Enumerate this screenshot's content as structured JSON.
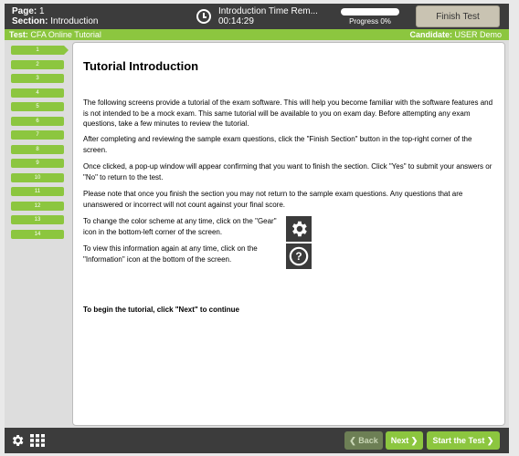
{
  "header": {
    "page_label": "Page:",
    "page_value": "1",
    "section_label": "Section:",
    "section_value": "Introduction",
    "timer_title": "Introduction Time Rem...",
    "timer_value": "00:14:29",
    "progress_label": "Progress 0%",
    "progress_fraction": 0,
    "finish_button": "Finish Test"
  },
  "greenbar": {
    "test_label": "Test:",
    "test_value": "CFA Online Tutorial",
    "candidate_label": "Candidate:",
    "candidate_value": "USER Demo"
  },
  "sidebar": {
    "items": [
      {
        "label": "1"
      },
      {
        "label": "2"
      },
      {
        "label": "3"
      },
      {
        "label": "4"
      },
      {
        "label": "5"
      },
      {
        "label": "6"
      },
      {
        "label": "7"
      },
      {
        "label": "8"
      },
      {
        "label": "9"
      },
      {
        "label": "10"
      },
      {
        "label": "11"
      },
      {
        "label": "12"
      },
      {
        "label": "13"
      },
      {
        "label": "14"
      }
    ]
  },
  "content": {
    "title": "Tutorial Introduction",
    "para1": "The following screens provide a tutorial of the exam software. This will help you become familiar with the software features and is not intended to be a mock exam. This same tutorial will be available to you on exam day. Before attempting any exam questions, take a few minutes to review the tutorial.",
    "para2": "After completing and reviewing the sample exam questions, click the \"Finish Section\" button in the top-right corner of the screen.",
    "para3": "Once clicked, a pop-up window will appear confirming that you want to finish the section. Click \"Yes\" to submit your answers or \"No\" to return to the test.",
    "para4": "Please note that once you finish the section you may not return to the sample exam questions. Any questions that are unanswered or incorrect will not count against your final score.",
    "gear_text": "To change the color scheme at any time, click on the \"Gear\" icon in the bottom-left corner of the screen.",
    "info_text": "To view this information again at any time, click on the \"Information\" icon at the bottom of the screen.",
    "final": "To begin the tutorial, click \"Next\" to continue"
  },
  "footer": {
    "back": "Back",
    "next": "Next",
    "start": "Start the Test"
  },
  "colors": {
    "accent": "#8cc63f",
    "dark": "#3c3c3c"
  },
  "icons": [
    "gear-icon",
    "grid-icon",
    "info-icon",
    "clock-icon",
    "chevron-left-icon",
    "chevron-right-icon"
  ]
}
